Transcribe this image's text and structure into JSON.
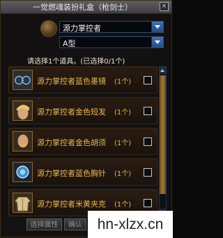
{
  "window": {
    "title": "一觉燃魂装扮礼盒（枪剑士）",
    "close_label": "×"
  },
  "selects": {
    "primary": {
      "value": "源力掌控者"
    },
    "secondary": {
      "value": "A型"
    }
  },
  "prompt": "请选择1个道具。(已选择0/1个)",
  "items": [
    {
      "name": "源力掌控者蓝色墨镜",
      "qty": "(1个)",
      "icon": "goggles-icon"
    },
    {
      "name": "源力掌控者金色短发",
      "qty": "(1个)",
      "icon": "short-hair-icon"
    },
    {
      "name": "源力掌控者金色胡须",
      "qty": "(1个)",
      "icon": "beard-icon"
    },
    {
      "name": "源力掌控者蓝色胸针",
      "qty": "(1个)",
      "icon": "brooch-icon"
    },
    {
      "name": "源力掌控者米黄夹克",
      "qty": "(1个)",
      "icon": "jacket-icon"
    }
  ],
  "buttons": {
    "select_attr": "选择属性",
    "confirm": "确认"
  },
  "watermark": "hn-xlzx.cn",
  "colors": {
    "item_text": "#e8b64b",
    "title_bar": "#4e4e52",
    "select_border": "#354a6c"
  }
}
